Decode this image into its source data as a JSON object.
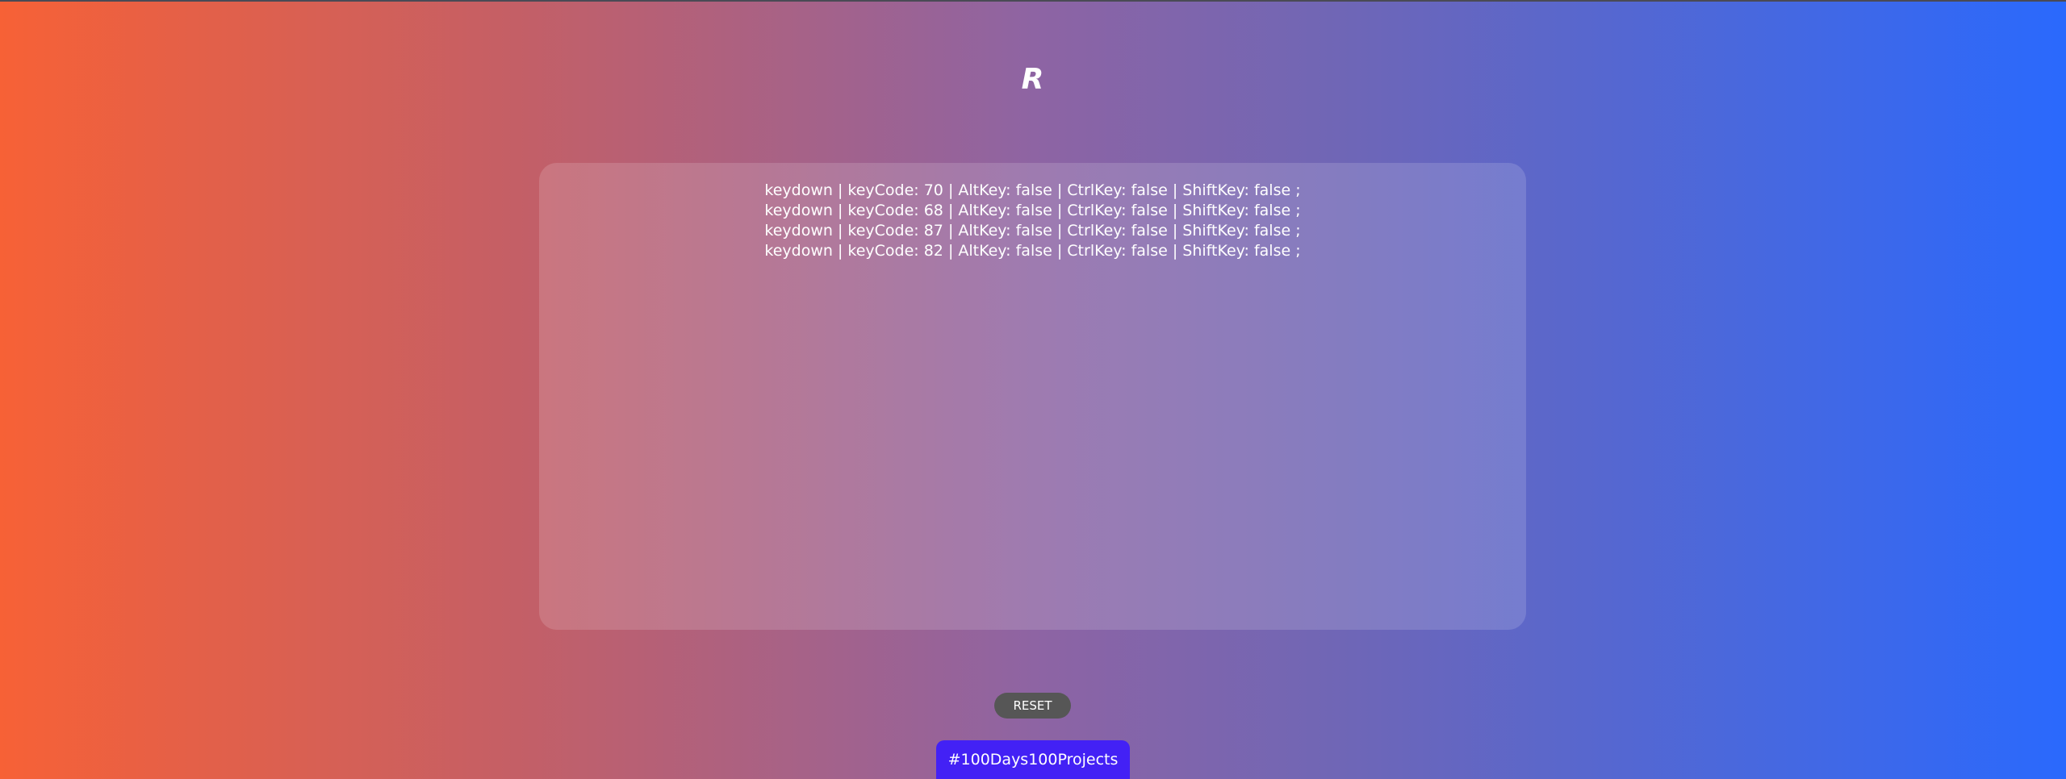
{
  "key_display": "R",
  "log": {
    "lines": [
      "keydown | keyCode: 70 | AltKey: false | CtrlKey: false | ShiftKey: false ;",
      "keydown | keyCode: 68 | AltKey: false | CtrlKey: false | ShiftKey: false ;",
      "keydown | keyCode: 87 | AltKey: false | CtrlKey: false | ShiftKey: false ;",
      "keydown | keyCode: 82 | AltKey: false | CtrlKey: false | ShiftKey: false ;"
    ]
  },
  "controls": {
    "reset_label": "RESET"
  },
  "footer": {
    "badge_label": "#100Days100Projects"
  },
  "colors": {
    "gradient_start": "#f76136",
    "gradient_end": "#2a69fd",
    "badge": "#4321f5",
    "reset_button": "#565656"
  }
}
